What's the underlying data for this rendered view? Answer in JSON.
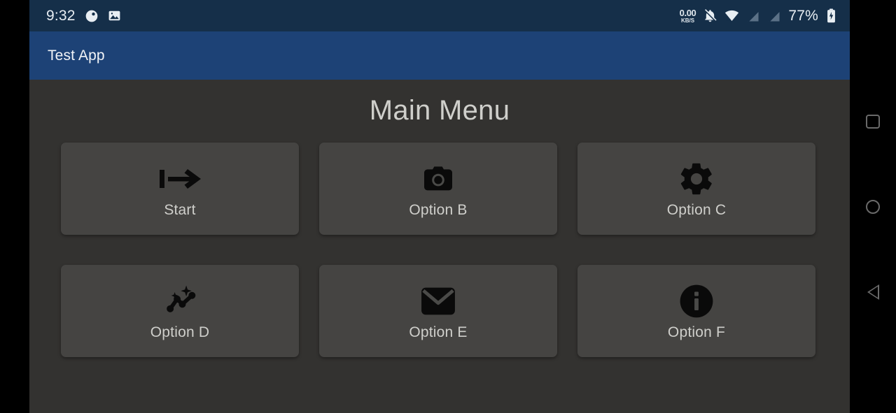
{
  "status_bar": {
    "clock": "9:32",
    "left_icons": [
      {
        "name": "dnd-circle-icon",
        "label": "do-not-disturb"
      },
      {
        "name": "gallery-image-icon",
        "label": "image"
      }
    ],
    "network_speed": {
      "value": "0.00",
      "unit": "KB/S"
    },
    "right_icons": [
      {
        "name": "notifications-muted-icon",
        "label": "notifications off"
      },
      {
        "name": "wifi-icon",
        "label": "wi-fi"
      },
      {
        "name": "signal-slot-1-icon",
        "label": "signal 1"
      },
      {
        "name": "signal-slot-2-icon",
        "label": "signal 2"
      }
    ],
    "battery_percent": "77%",
    "battery_icon": "battery-charging-icon",
    "background_color": "#152F49"
  },
  "app_bar": {
    "title": "Test App",
    "background_color": "#1D4276",
    "text_color": "#F1F4F8"
  },
  "content": {
    "page_title": "Main Menu",
    "background_color": "#333230",
    "card_color": "#454442",
    "label_color": "#CFCFCB",
    "menu_items": [
      {
        "label": "Start",
        "icon": "start-arrow-icon"
      },
      {
        "label": "Option B",
        "icon": "camera-icon"
      },
      {
        "label": "Option C",
        "icon": "gear-icon"
      },
      {
        "label": "Option D",
        "icon": "auto-graph-icon"
      },
      {
        "label": "Option E",
        "icon": "email-icon"
      },
      {
        "label": "Option F",
        "icon": "info-icon"
      }
    ]
  },
  "nav_bar": {
    "background_color": "#000000",
    "buttons": [
      {
        "name": "recents-button",
        "icon": "square-icon"
      },
      {
        "name": "home-button",
        "icon": "circle-icon"
      },
      {
        "name": "back-button",
        "icon": "triangle-left-icon"
      }
    ]
  }
}
